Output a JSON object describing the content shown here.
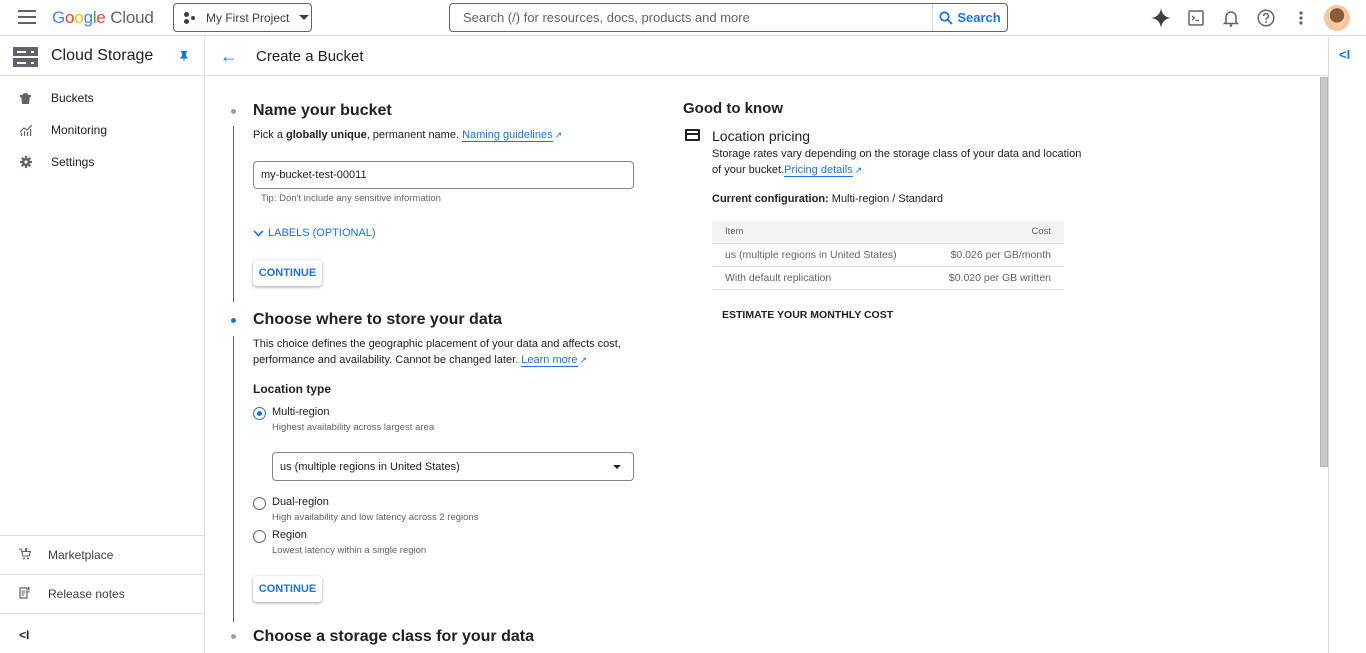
{
  "topbar": {
    "brand": {
      "g1": "G",
      "g2": "o",
      "g3": "o",
      "g4": "g",
      "g5": "l",
      "g6": "e",
      "cloud": "Cloud"
    },
    "project": "My First Project",
    "search_placeholder": "Search (/) for resources, docs, products and more",
    "search_button": "Search",
    "icons": [
      "gemini-icon",
      "cloud-shell-icon",
      "notifications-icon",
      "help-icon",
      "more-vert-icon",
      "avatar"
    ]
  },
  "sidebar": {
    "title": "Cloud Storage",
    "items": [
      {
        "label": "Buckets",
        "icon": "bucket-icon"
      },
      {
        "label": "Monitoring",
        "icon": "monitoring-icon"
      },
      {
        "label": "Settings",
        "icon": "settings-icon"
      }
    ],
    "bottom_items": [
      {
        "label": "Marketplace",
        "icon": "marketplace-icon"
      },
      {
        "label": "Release notes",
        "icon": "release-notes-icon"
      }
    ],
    "collapse_label": "<I"
  },
  "page": {
    "title": "Create a Bucket",
    "right_collapse": "<I"
  },
  "step1": {
    "title": "Name your bucket",
    "desc_pre": "Pick a ",
    "desc_bold": "globally unique",
    "desc_post": ", permanent name. ",
    "link": "Naming guidelines",
    "input_value": "my-bucket-test-00011",
    "tip": "Tip: Don't include any sensitive information",
    "labels_toggle": "LABELS (OPTIONAL)",
    "continue": "CONTINUE"
  },
  "step2": {
    "title": "Choose where to store your data",
    "desc_line1": "This choice defines the geographic placement of your data and affects cost,",
    "desc_line2": "performance and availability. Cannot be changed later. ",
    "link": "Learn more",
    "location_type_label": "Location type",
    "options": [
      {
        "label": "Multi-region",
        "desc": "Highest availability across largest area",
        "checked": true
      },
      {
        "label": "Dual-region",
        "desc": "High availability and low latency across 2 regions",
        "checked": false
      },
      {
        "label": "Region",
        "desc": "Lowest latency within a single region",
        "checked": false
      }
    ],
    "select_value": "us (multiple regions in United States)",
    "continue": "CONTINUE"
  },
  "step3": {
    "title": "Choose a storage class for your data"
  },
  "good_to_know": {
    "title": "Good to know",
    "section_title": "Location pricing",
    "desc_line1": "Storage rates vary depending on the storage class of your data and location",
    "desc_line2": "of your bucket.",
    "link": "Pricing details",
    "config_label": "Current configuration:",
    "config_value": " Multi-region / Standard",
    "table": {
      "headers": [
        "Item",
        "Cost"
      ],
      "rows": [
        [
          "us (multiple regions in United States)",
          "$0.026 per GB/month"
        ],
        [
          "With default replication",
          "$0.020 per GB written"
        ]
      ]
    },
    "estimate_button": "ESTIMATE YOUR MONTHLY COST"
  }
}
